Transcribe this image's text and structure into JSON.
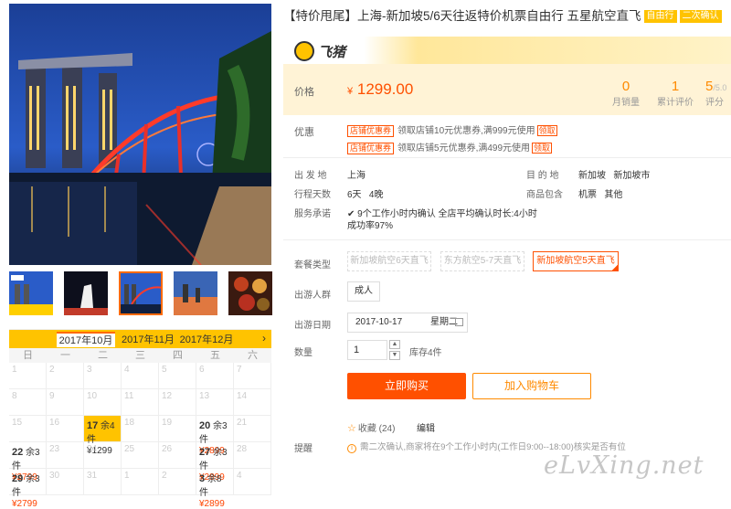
{
  "product": {
    "title": "【特价甩尾】上海-新加坡5/6天往返特价机票自由行 五星航空直飞",
    "tags": [
      "自由行",
      "二次确认"
    ]
  },
  "brand": {
    "logo_icon": "feizhu-pig-icon",
    "name": "飞猪"
  },
  "price": {
    "label": "价格",
    "currency": "¥",
    "value": "1299.00"
  },
  "stats": [
    {
      "value": "0",
      "label": "月销量"
    },
    {
      "value": "1",
      "label": "累计评价"
    },
    {
      "value": "5",
      "label": "评分"
    }
  ],
  "rating_suffix": "/5.0",
  "coupons": {
    "label": "优惠",
    "items": [
      {
        "tag": "店铺优惠券",
        "text": "领取店铺10元优惠券,满999元使用",
        "link": "领取"
      },
      {
        "tag": "店铺优惠券",
        "text": "领取店铺5元优惠券,满499元使用",
        "link": "领取"
      }
    ]
  },
  "info": {
    "depart_label": "出 发 地",
    "depart": "上海",
    "dest_label": "目 的 地",
    "dest": "新加坡   新加坡市",
    "days_label": "行程天数",
    "days": "6天   4晚",
    "includes_label": "商品包含",
    "includes": "机票   其他",
    "promise_label": "服务承诺",
    "promise": "9个工作小时内确认 全店平均确认时长:4小时",
    "promise2": "成功率97%"
  },
  "package": {
    "label": "套餐类型",
    "options": [
      "新加坡航空6天直飞",
      "东方航空5-7天直飞",
      "新加坡航空5天直飞"
    ],
    "selected": 2
  },
  "crowd": {
    "label": "出游人群",
    "value": "成人"
  },
  "travel_date": {
    "label": "出游日期",
    "value": "2017-10-17",
    "weekday": "星期二"
  },
  "quantity": {
    "label": "数量",
    "value": "1",
    "stock": "库存4件",
    "up": "▲",
    "down": "▼"
  },
  "buttons": {
    "buy": "立即购买",
    "cart": "加入购物车"
  },
  "favorite": {
    "label": "收藏",
    "count": "(24)",
    "edit": "编辑"
  },
  "remind": {
    "label": "提醒",
    "text": "需二次确认,商家将在9个工作小时内(工作日9:00--18:00)核实是否有位"
  },
  "calendar": {
    "months": [
      "2017年10月",
      "2017年11月",
      "2017年12月"
    ],
    "next": "›",
    "weekdays": [
      "日",
      "一",
      "二",
      "三",
      "四",
      "五",
      "六"
    ],
    "days": [
      {
        "d": "1"
      },
      {
        "d": "2"
      },
      {
        "d": "3"
      },
      {
        "d": "4"
      },
      {
        "d": "5"
      },
      {
        "d": "6"
      },
      {
        "d": "7"
      },
      {
        "d": "8"
      },
      {
        "d": "9"
      },
      {
        "d": "10"
      },
      {
        "d": "11"
      },
      {
        "d": "12"
      },
      {
        "d": "13"
      },
      {
        "d": "14"
      },
      {
        "d": "15"
      },
      {
        "d": "16"
      },
      {
        "d": "17",
        "rest": "余4件",
        "price": "¥1299",
        "sel": true
      },
      {
        "d": "18"
      },
      {
        "d": "19"
      },
      {
        "d": "20",
        "rest": "余3件",
        "price": "¥2899"
      },
      {
        "d": "21"
      },
      {
        "d": "22",
        "rest": "余3件",
        "price": "¥2799"
      },
      {
        "d": "23"
      },
      {
        "d": "24"
      },
      {
        "d": "25"
      },
      {
        "d": "26"
      },
      {
        "d": "27",
        "rest": "余3件",
        "price": "¥2899"
      },
      {
        "d": "28"
      },
      {
        "d": "29",
        "rest": "余3件",
        "price": "¥2799"
      },
      {
        "d": "30"
      },
      {
        "d": "31"
      },
      {
        "d": "1"
      },
      {
        "d": "2"
      },
      {
        "d": "3",
        "rest": "余8件",
        "price": "¥2899"
      },
      {
        "d": "4"
      }
    ]
  },
  "watermark": "eLvXing.net"
}
